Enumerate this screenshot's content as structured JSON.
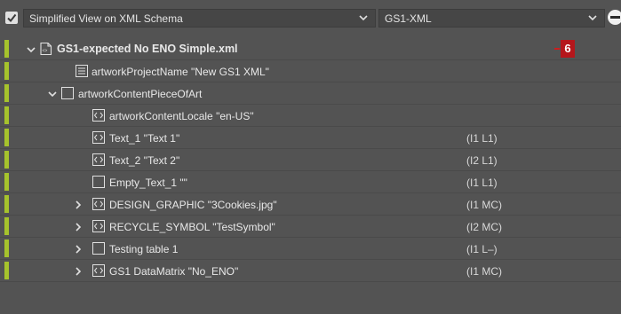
{
  "toolbar": {
    "view_checkbox_checked": true,
    "view_select_value": "Simplified View on XML Schema",
    "format_select_value": "GS1-XML"
  },
  "tree": {
    "root": {
      "label": "GS1-expected No ENO Simple.xml",
      "badge": "6",
      "expanded": true
    },
    "rows": [
      {
        "label": "artworkProjectName  \"New GS1 XML\"",
        "icon": "element-icon"
      },
      {
        "label": "artworkContentPieceOfArt",
        "icon": "box-icon",
        "expanded": true
      },
      {
        "label": "artworkContentLocale  \"en-US\"",
        "icon": "code-icon"
      },
      {
        "label": "Text_1  \"Text 1\"",
        "icon": "code-icon",
        "code": "(I1 L1)"
      },
      {
        "label": "Text_2  \"Text 2\"",
        "icon": "code-icon",
        "code": "(I2 L1)"
      },
      {
        "label": "Empty_Text_1  \"\"",
        "icon": "box-icon",
        "code": "(I1 L1)"
      },
      {
        "label": "DESIGN_GRAPHIC  \"3Cookies.jpg\"",
        "icon": "code-icon",
        "code": "(I1 MC)",
        "collapsed": true
      },
      {
        "label": "RECYCLE_SYMBOL  \"TestSymbol\"",
        "icon": "code-icon",
        "code": "(I2 MC)",
        "collapsed": true
      },
      {
        "label": "Testing table 1",
        "icon": "box-icon",
        "code": "(I1 L–)",
        "collapsed": true
      },
      {
        "label": "GS1 DataMatrix  \"No_ENO\"",
        "icon": "code-icon",
        "code": "(I1 MC)",
        "collapsed": true
      }
    ]
  },
  "colors": {
    "accent_bar": "#a6c32c",
    "badge": "#b5161b",
    "background": "#535353"
  }
}
